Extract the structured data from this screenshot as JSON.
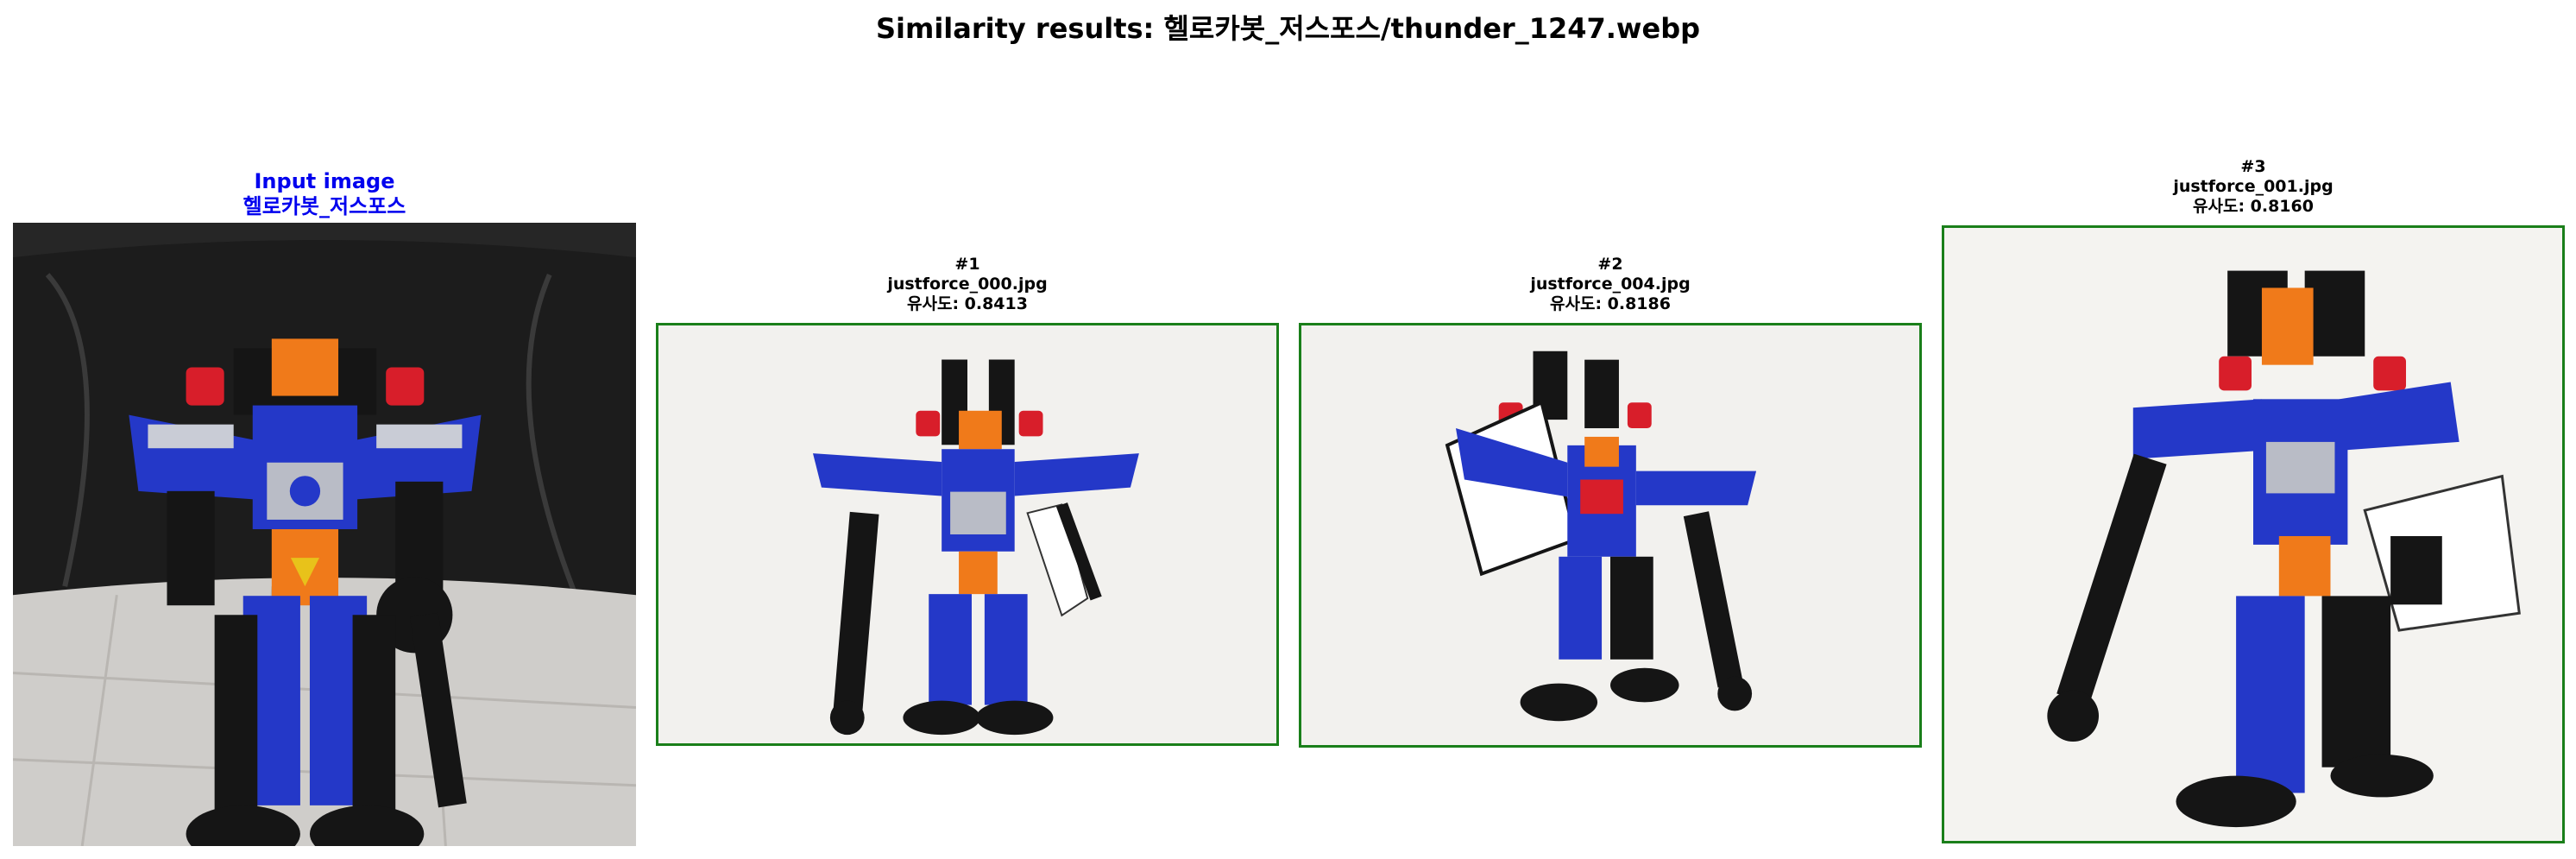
{
  "title": "Similarity results: 헬로카봇_저스포스/thunder_1247.webp",
  "input": {
    "label": "Input image",
    "class_name": "헬로카봇_저스포스",
    "label_color": "#0000ee"
  },
  "results": [
    {
      "rank": "#1",
      "filename": "justforce_000.jpg",
      "score_text": "유사도: 0.8413",
      "similarity": 0.8413
    },
    {
      "rank": "#2",
      "filename": "justforce_004.jpg",
      "score_text": "유사도: 0.8186",
      "similarity": 0.8186
    },
    {
      "rank": "#3",
      "filename": "justforce_001.jpg",
      "score_text": "유사도: 0.8160",
      "similarity": 0.816
    }
  ],
  "colors": {
    "result_border": "#1a7f1a",
    "robot_blue": "#2438c8",
    "robot_orange": "#f07a1a",
    "robot_black": "#151515"
  }
}
